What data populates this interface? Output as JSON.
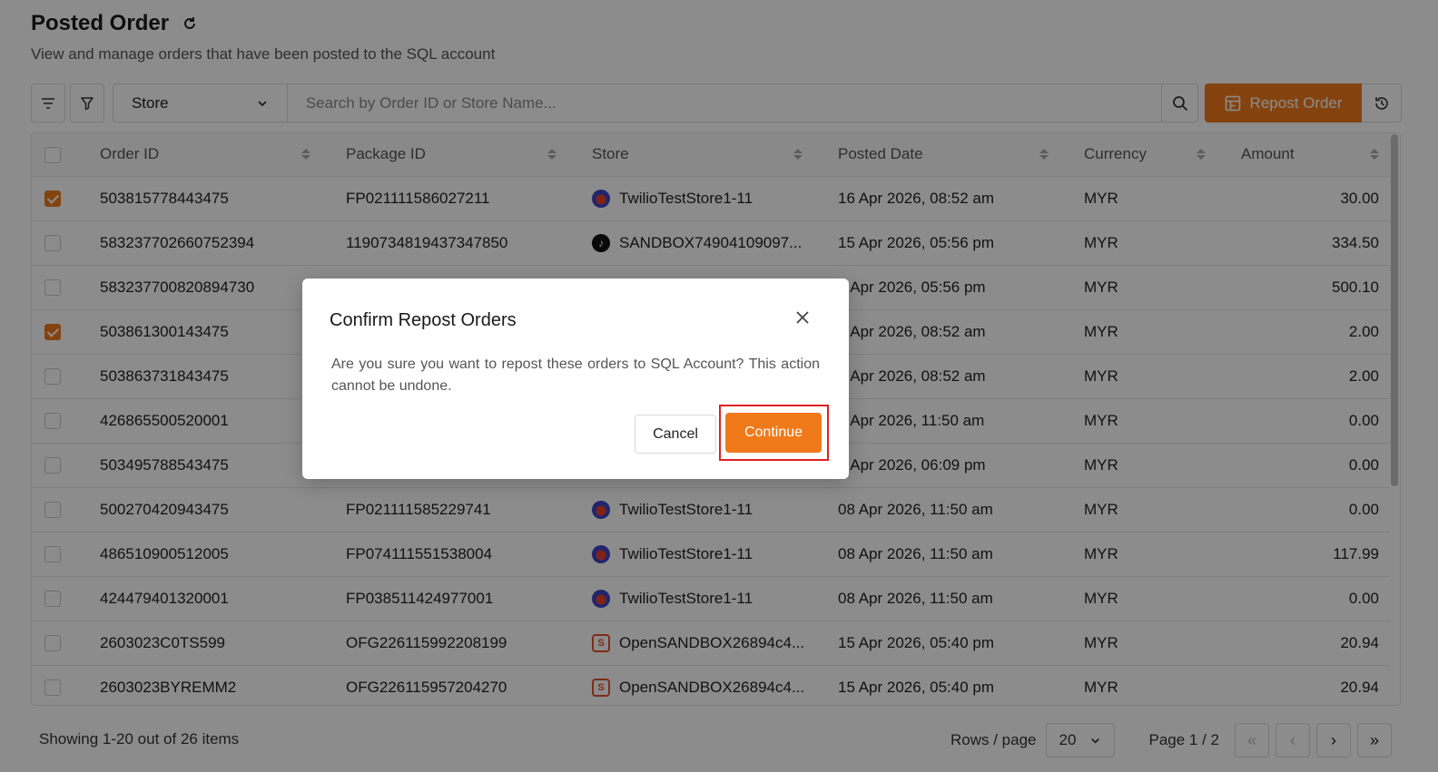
{
  "header": {
    "title": "Posted Order",
    "subtitle": "View and manage orders that have been posted to the SQL account"
  },
  "toolbar": {
    "store_select": "Store",
    "search_placeholder": "Search by Order ID or Store Name...",
    "repost_label": "Repost Order"
  },
  "table": {
    "columns": [
      "Order ID",
      "Package ID",
      "Store",
      "Posted Date",
      "Currency",
      "Amount"
    ],
    "rows": [
      {
        "checked": true,
        "order_id": "503815778443475",
        "package_id": "FP021111586027211",
        "store": "TwilioTestStore1-11",
        "store_icon": "twilio",
        "posted_date": "16 Apr 2026, 08:52 am",
        "currency": "MYR",
        "amount": "30.00"
      },
      {
        "checked": false,
        "order_id": "583237702660752394",
        "package_id": "1190734819437347850",
        "store": "SANDBOX74904109097...",
        "store_icon": "tiktok",
        "posted_date": "15 Apr 2026, 05:56 pm",
        "currency": "MYR",
        "amount": "334.50"
      },
      {
        "checked": false,
        "order_id": "583237700820894730",
        "package_id": "",
        "store": "",
        "store_icon": "",
        "posted_date": "5 Apr 2026, 05:56 pm",
        "currency": "MYR",
        "amount": "500.10"
      },
      {
        "checked": true,
        "order_id": "503861300143475",
        "package_id": "",
        "store": "",
        "store_icon": "",
        "posted_date": "6 Apr 2026, 08:52 am",
        "currency": "MYR",
        "amount": "2.00"
      },
      {
        "checked": false,
        "order_id": "503863731843475",
        "package_id": "",
        "store": "",
        "store_icon": "",
        "posted_date": "6 Apr 2026, 08:52 am",
        "currency": "MYR",
        "amount": "2.00"
      },
      {
        "checked": false,
        "order_id": "426865500520001",
        "package_id": "",
        "store": "",
        "store_icon": "",
        "posted_date": "8 Apr 2026, 11:50 am",
        "currency": "MYR",
        "amount": "0.00"
      },
      {
        "checked": false,
        "order_id": "503495788543475",
        "package_id": "",
        "store": "",
        "store_icon": "",
        "posted_date": "5 Apr 2026, 06:09 pm",
        "currency": "MYR",
        "amount": "0.00"
      },
      {
        "checked": false,
        "order_id": "500270420943475",
        "package_id": "FP021111585229741",
        "store": "TwilioTestStore1-11",
        "store_icon": "twilio",
        "posted_date": "08 Apr 2026, 11:50 am",
        "currency": "MYR",
        "amount": "0.00"
      },
      {
        "checked": false,
        "order_id": "486510900512005",
        "package_id": "FP074111551538004",
        "store": "TwilioTestStore1-11",
        "store_icon": "twilio",
        "posted_date": "08 Apr 2026, 11:50 am",
        "currency": "MYR",
        "amount": "117.99"
      },
      {
        "checked": false,
        "order_id": "424479401320001",
        "package_id": "FP038511424977001",
        "store": "TwilioTestStore1-11",
        "store_icon": "twilio",
        "posted_date": "08 Apr 2026, 11:50 am",
        "currency": "MYR",
        "amount": "0.00"
      },
      {
        "checked": false,
        "order_id": "2603023C0TS599",
        "package_id": "OFG226115992208199",
        "store": "OpenSANDBOX26894c4...",
        "store_icon": "shopee",
        "posted_date": "15 Apr 2026, 05:40 pm",
        "currency": "MYR",
        "amount": "20.94"
      },
      {
        "checked": false,
        "order_id": "2603023BYREMM2",
        "package_id": "OFG226115957204270",
        "store": "OpenSANDBOX26894c4...",
        "store_icon": "shopee",
        "posted_date": "15 Apr 2026, 05:40 pm",
        "currency": "MYR",
        "amount": "20.94"
      }
    ]
  },
  "footer": {
    "showing": "Showing 1-20 out of 26 items",
    "rows_label": "Rows / page",
    "rows_value": "20",
    "page_label": "Page 1 / 2"
  },
  "modal": {
    "title": "Confirm Repost Orders",
    "body": "Are you sure you want to repost these orders to SQL Account? This action cannot be undone.",
    "cancel_label": "Cancel",
    "continue_label": "Continue"
  },
  "colors": {
    "accent": "#f07a1a",
    "highlight": "#e02020"
  }
}
